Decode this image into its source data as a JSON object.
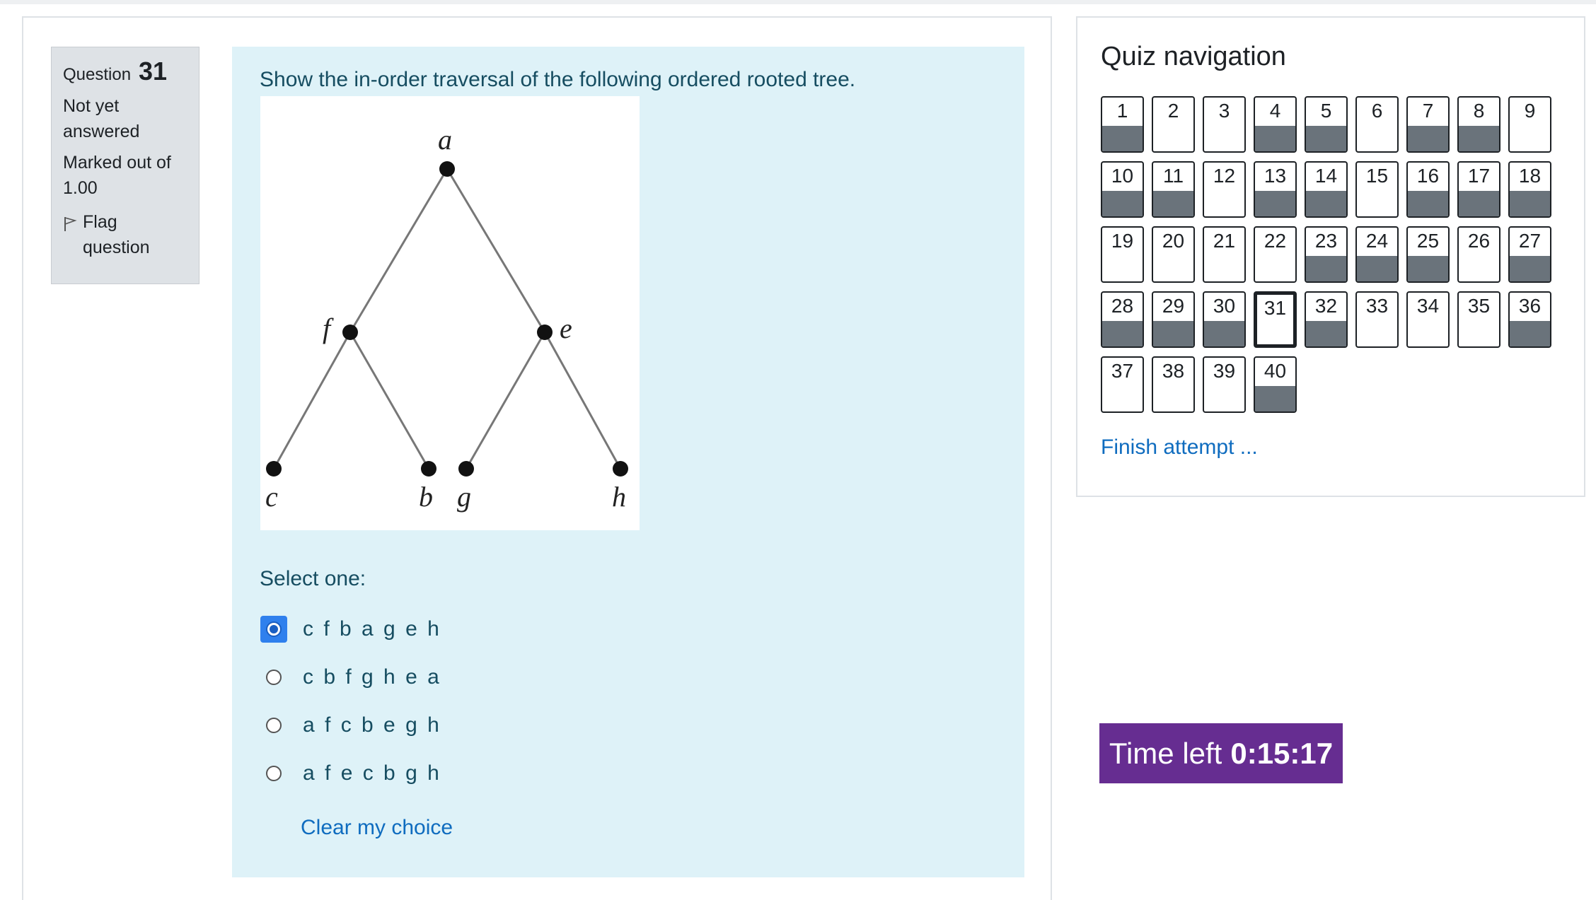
{
  "question_info": {
    "label": "Question",
    "number": "31",
    "state_line1": "Not yet",
    "state_line2": "answered",
    "marks_line1": "Marked out of",
    "marks_line2": "1.00",
    "flag_line1": "Flag",
    "flag_line2": "question"
  },
  "question": {
    "text": "Show the in-order traversal of the following ordered rooted tree.",
    "figure": {
      "nodes": [
        "a",
        "f",
        "e",
        "c",
        "b",
        "g",
        "h"
      ]
    },
    "select_label": "Select one:",
    "options": [
      {
        "label": "c f b a g e h",
        "selected": true
      },
      {
        "label": "c b f g h e a",
        "selected": false
      },
      {
        "label": "a f c b e g h",
        "selected": false
      },
      {
        "label": "a f e c b g h",
        "selected": false
      }
    ],
    "clear_label": "Clear my choice"
  },
  "navigation": {
    "title": "Quiz navigation",
    "buttons": [
      "1",
      "2",
      "3",
      "4",
      "5",
      "6",
      "7",
      "8",
      "9",
      "10",
      "11",
      "12",
      "13",
      "14",
      "15",
      "16",
      "17",
      "18",
      "19",
      "20",
      "21",
      "22",
      "23",
      "24",
      "25",
      "26",
      "27",
      "28",
      "29",
      "30",
      "31",
      "32",
      "33",
      "34",
      "35",
      "36",
      "37",
      "38",
      "39",
      "40"
    ],
    "answered": [
      1,
      4,
      5,
      7,
      8,
      10,
      11,
      13,
      14,
      16,
      17,
      18,
      23,
      24,
      25,
      27,
      28,
      29,
      30,
      32,
      36,
      40
    ],
    "current": 31,
    "finish_label": "Finish attempt ..."
  },
  "timer": {
    "label": "Time left",
    "value": "0:15:17"
  },
  "colors": {
    "content_bg": "#def2f8",
    "text_teal": "#164d61",
    "link": "#0f6cbf",
    "timer_bg": "#662d91",
    "answered_bar": "#6a737b",
    "radio_selected": "#2f80ed"
  }
}
